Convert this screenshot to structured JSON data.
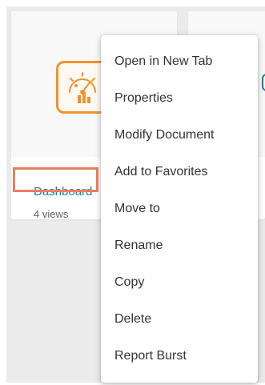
{
  "card": {
    "title": "Dashboard",
    "subtitle": "4 views",
    "icon": "dashboard-app-icon"
  },
  "context_menu": {
    "items": [
      {
        "label": "Open in New Tab"
      },
      {
        "label": "Properties"
      },
      {
        "label": "Modify Document"
      },
      {
        "label": "Add to Favorites"
      },
      {
        "label": "Move to"
      },
      {
        "label": "Rename"
      },
      {
        "label": "Copy"
      },
      {
        "label": "Delete"
      },
      {
        "label": "Report Burst"
      }
    ]
  },
  "colors": {
    "accent_orange": "#f0932b",
    "highlight_border": "#ec7e5f",
    "title_teal": "#1c8396",
    "background_grey": "#ebebeb"
  }
}
